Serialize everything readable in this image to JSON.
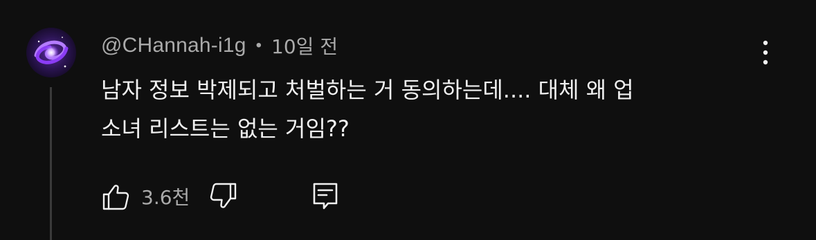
{
  "comment": {
    "author": "@CHannah-i1g",
    "separator": "•",
    "time": "10일 전",
    "text_line1": "남자 정보 박제되고 처벌하는 거 동의하는데.... 대체 왜 업",
    "text_line2": "소녀 리스트는 없는 거임??",
    "like_count": "3.6천"
  },
  "colors": {
    "background": "#0f0f0f",
    "text_primary": "#f1f1f1",
    "text_secondary": "#aaaaaa",
    "avatar_accent": "#8b3cf5"
  },
  "icons": {
    "avatar": "galaxy-avatar",
    "like": "thumbs-up-icon",
    "dislike": "thumbs-down-icon",
    "reply": "reply-comment-icon",
    "more": "more-vertical-icon"
  }
}
